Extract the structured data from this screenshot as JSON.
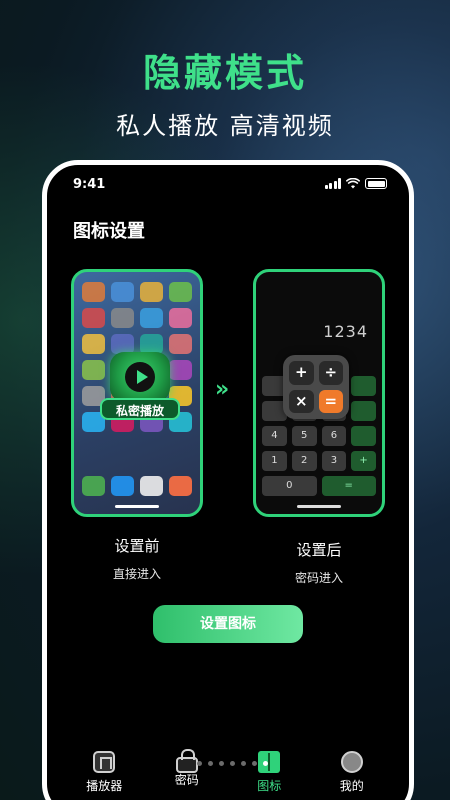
{
  "promo": {
    "headline": "隐藏模式",
    "subline": "私人播放 高清视频"
  },
  "statusbar": {
    "time": "9:41"
  },
  "screen": {
    "section_title": "图标设置",
    "before": {
      "app_label": "私密播放",
      "title": "设置前",
      "subtitle": "直接进入"
    },
    "after": {
      "display_value": "1234",
      "popup_keys": [
        "+",
        "÷",
        "×",
        "="
      ],
      "title": "设置后",
      "subtitle": "密码进入"
    },
    "arrow_glyph": "»",
    "cta_label": "设置图标"
  },
  "pager": {
    "total": 7,
    "active_index": 6
  },
  "tabbar": {
    "items": [
      {
        "label": "播放器",
        "icon": "home-icon"
      },
      {
        "label": "密码",
        "icon": "lock-icon"
      },
      {
        "label": "图标",
        "icon": "book-icon",
        "active": true
      },
      {
        "label": "我的",
        "icon": "profile-icon"
      }
    ]
  },
  "colors": {
    "accent": "#3fe08a",
    "frame": "#ffffff",
    "calc_orange": "#f07a2a"
  }
}
